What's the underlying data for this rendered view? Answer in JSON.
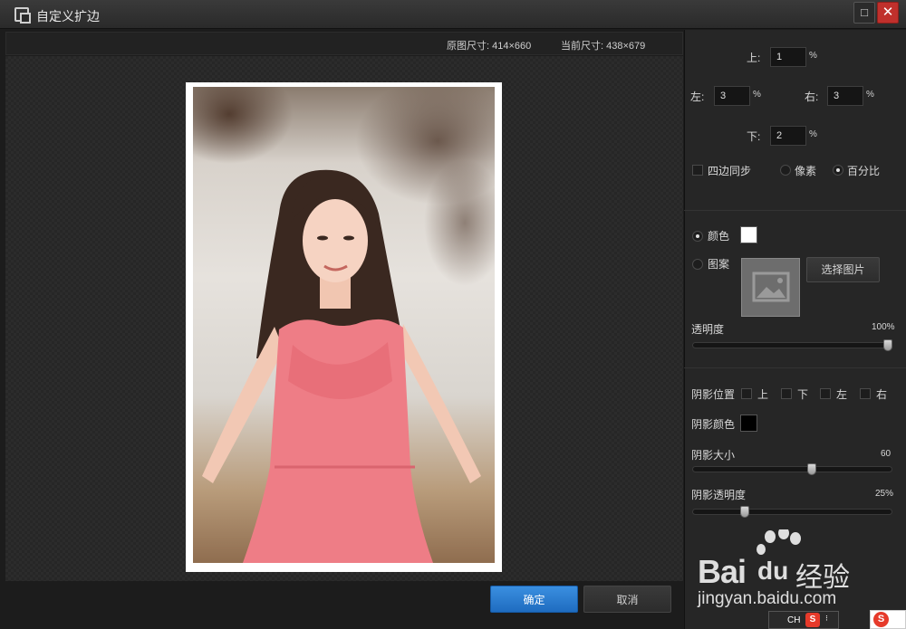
{
  "window": {
    "title": "自定义扩边",
    "maximize_glyph": "□",
    "close_glyph": "✕"
  },
  "preview": {
    "original_size": "原图尺寸: 414×660",
    "current_size": "当前尺寸: 438×679"
  },
  "buttons": {
    "ok": "确定",
    "cancel": "取消",
    "select_image": "选择图片"
  },
  "border": {
    "top_label": "上:",
    "top_value": "1",
    "left_label": "左:",
    "left_value": "3",
    "right_label": "右:",
    "right_value": "3",
    "bottom_label": "下:",
    "bottom_value": "2",
    "unit": "%",
    "sync_label": "四边同步",
    "pixel_label": "像素",
    "percent_label": "百分比"
  },
  "fill": {
    "color_label": "颜色",
    "color_value": "#ffffff",
    "pattern_label": "图案",
    "opacity_label": "透明度",
    "opacity_value": "100%",
    "opacity_fraction": 1.0
  },
  "shadow": {
    "position_label": "阴影位置",
    "pos_top": "上",
    "pos_bottom": "下",
    "pos_left": "左",
    "pos_right": "右",
    "color_label": "阴影颜色",
    "color_value": "#000000",
    "size_label": "阴影大小",
    "size_value": "60",
    "size_fraction": 0.6,
    "opacity_label": "阴影透明度",
    "opacity_value": "25%",
    "opacity_fraction": 0.25
  },
  "watermark": {
    "brand": "Bai",
    "brand_tail": "du",
    "cn": "经验",
    "url": "jingyan.baidu.com"
  },
  "ime": {
    "lang": "CH",
    "logo": "S"
  }
}
